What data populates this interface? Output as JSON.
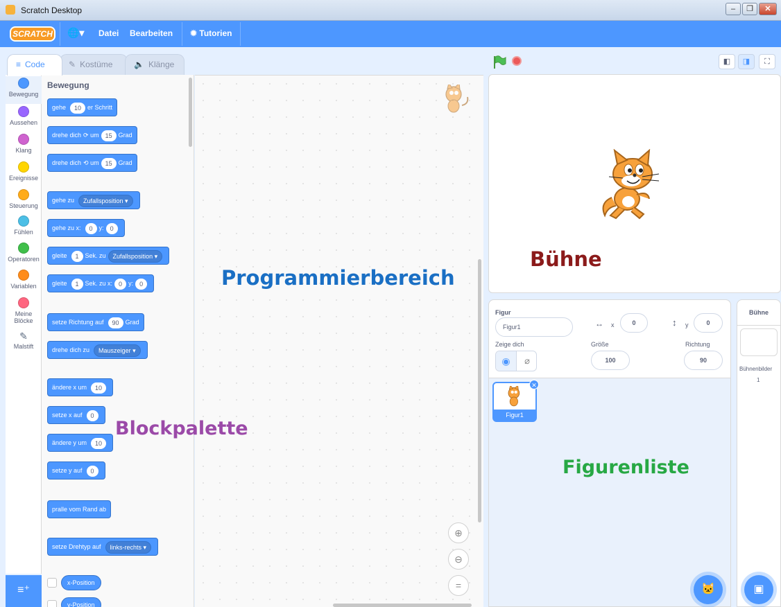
{
  "window": {
    "title": "Scratch Desktop",
    "controls": [
      "–",
      "❐",
      "✕"
    ]
  },
  "menubar": {
    "logo": "SCRATCH",
    "globe": "🌐▾",
    "file": "Datei",
    "edit": "Bearbeiten",
    "tutorials": "Tutorien"
  },
  "tabs": {
    "code": "Code",
    "costumes": "Kostüme",
    "sounds": "Klänge"
  },
  "categories": [
    {
      "label": "Bewegung",
      "color": "#4c97ff"
    },
    {
      "label": "Aussehen",
      "color": "#9966ff"
    },
    {
      "label": "Klang",
      "color": "#cf63cf"
    },
    {
      "label": "Ereignisse",
      "color": "#ffd500"
    },
    {
      "label": "Steuerung",
      "color": "#ffab19"
    },
    {
      "label": "Fühlen",
      "color": "#4cbfe6"
    },
    {
      "label": "Operatoren",
      "color": "#40bf4a"
    },
    {
      "label": "Variablen",
      "color": "#ff8c1a"
    },
    {
      "label": "Meine Blöcke",
      "color": "#ff6680"
    },
    {
      "label": "Malstift",
      "color": "#0fbd8c"
    }
  ],
  "palette": {
    "heading": "Bewegung",
    "blocks": {
      "move_a": "gehe",
      "move_v": "10",
      "move_b": "er Schritt",
      "turn_r_a": "drehe dich",
      "turn_r_b": "um",
      "turn_r_v": "15",
      "turn_r_c": "Grad",
      "turn_l_a": "drehe dich",
      "turn_l_b": "um",
      "turn_l_v": "15",
      "turn_l_c": "Grad",
      "goto_a": "gehe zu",
      "goto_dd": "Zufallsposition ▾",
      "gotoxy_a": "gehe zu x:",
      "gotoxy_x": "0",
      "gotoxy_b": "y:",
      "gotoxy_y": "0",
      "glide_a": "gleite",
      "glide_v": "1",
      "glide_b": "Sek. zu",
      "glide_dd": "Zufallsposition ▾",
      "glidexy_a": "gleite",
      "glidexy_v": "1",
      "glidexy_b": "Sek. zu x:",
      "glidexy_x": "0",
      "glidexy_c": "y:",
      "glidexy_y": "0",
      "dir_a": "setze Richtung auf",
      "dir_v": "90",
      "dir_b": "Grad",
      "point_a": "drehe dich zu",
      "point_dd": "Mauszeiger ▾",
      "chx_a": "ändere x um",
      "chx_v": "10",
      "setx_a": "setze x auf",
      "setx_v": "0",
      "chy_a": "ändere y um",
      "chy_v": "10",
      "sety_a": "setze y auf",
      "sety_v": "0",
      "bounce": "pralle vom Rand ab",
      "rot_a": "setze Drehtyp auf",
      "rot_dd": "links-rechts ▾",
      "rep_x": "x-Position",
      "rep_y": "y-Position"
    }
  },
  "script_area": {
    "zoom_in": "⊕",
    "zoom_out": "⊖",
    "zoom_reset": "="
  },
  "stage_controls": {
    "layout_small": "◧",
    "layout_normal": "◨",
    "fullscreen": "⛶"
  },
  "sprite_info": {
    "figure_label": "Figur",
    "figure_name": "Figur1",
    "x_label": "x",
    "x_value": "0",
    "y_label": "y",
    "y_value": "0",
    "show_label": "Zeige dich",
    "size_label": "Größe",
    "size_value": "100",
    "direction_label": "Richtung",
    "direction_value": "90"
  },
  "sprite_list": [
    {
      "name": "Figur1"
    }
  ],
  "stage_selector": {
    "title": "Bühne",
    "backdrops_label": "Bühnenbilder",
    "backdrops_count": "1"
  },
  "annotations": {
    "programming_area": "Programmierbereich",
    "stage": "Bühne",
    "block_palette": "Blockpalette",
    "sprite_list": "Figurenliste"
  },
  "colors": {
    "accent": "#4d97ff",
    "annotation_blue": "#1a6fc4",
    "annotation_red": "#8b1a1a",
    "annotation_purple": "#9b4aa8",
    "annotation_green": "#27a844"
  }
}
